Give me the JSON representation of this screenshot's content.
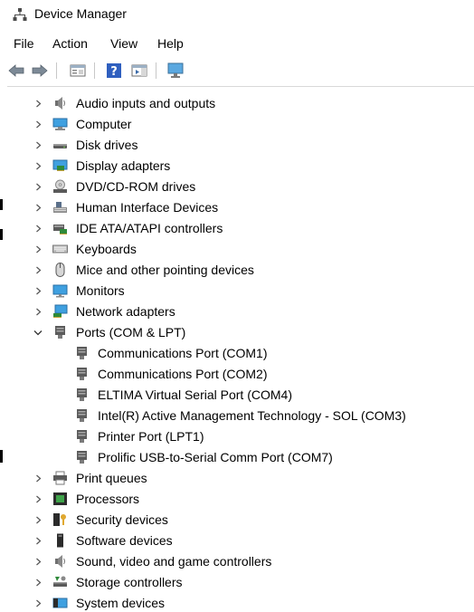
{
  "window": {
    "title": "Device Manager"
  },
  "menu": {
    "file": "File",
    "action": "Action",
    "view": "View",
    "help": "Help"
  },
  "toolbar": {
    "buttons": [
      "back-arrow-icon",
      "forward-arrow-icon",
      "properties-icon",
      "help-icon",
      "action-pane-icon",
      "monitor-scan-icon"
    ]
  },
  "tree": [
    {
      "label": "Audio inputs and outputs",
      "icon": "speaker-icon",
      "expanded": false
    },
    {
      "label": "Computer",
      "icon": "computer-icon",
      "expanded": false
    },
    {
      "label": "Disk drives",
      "icon": "disk-drive-icon",
      "expanded": false
    },
    {
      "label": "Display adapters",
      "icon": "display-adapter-icon",
      "expanded": false
    },
    {
      "label": "DVD/CD-ROM drives",
      "icon": "dvd-drive-icon",
      "expanded": false
    },
    {
      "label": "Human Interface Devices",
      "icon": "hid-icon",
      "expanded": false
    },
    {
      "label": "IDE ATA/ATAPI controllers",
      "icon": "ide-controller-icon",
      "expanded": false
    },
    {
      "label": "Keyboards",
      "icon": "keyboard-icon",
      "expanded": false
    },
    {
      "label": "Mice and other pointing devices",
      "icon": "mouse-icon",
      "expanded": false
    },
    {
      "label": "Monitors",
      "icon": "monitor-icon",
      "expanded": false
    },
    {
      "label": "Network adapters",
      "icon": "network-adapter-icon",
      "expanded": false
    },
    {
      "label": "Ports (COM & LPT)",
      "icon": "port-icon",
      "expanded": true,
      "children": [
        "Communications Port (COM1)",
        "Communications Port (COM2)",
        "ELTIMA Virtual Serial Port (COM4)",
        "Intel(R) Active Management Technology - SOL (COM3)",
        "Printer Port (LPT1)",
        "Prolific USB-to-Serial Comm Port (COM7)"
      ]
    },
    {
      "label": "Print queues",
      "icon": "printer-icon",
      "expanded": false
    },
    {
      "label": "Processors",
      "icon": "processor-icon",
      "expanded": false
    },
    {
      "label": "Security devices",
      "icon": "security-device-icon",
      "expanded": false
    },
    {
      "label": "Software devices",
      "icon": "software-device-icon",
      "expanded": false
    },
    {
      "label": "Sound, video and game controllers",
      "icon": "sound-controller-icon",
      "expanded": false
    },
    {
      "label": "Storage controllers",
      "icon": "storage-controller-icon",
      "expanded": false
    },
    {
      "label": "System devices",
      "icon": "system-devices-icon",
      "expanded": false
    }
  ]
}
